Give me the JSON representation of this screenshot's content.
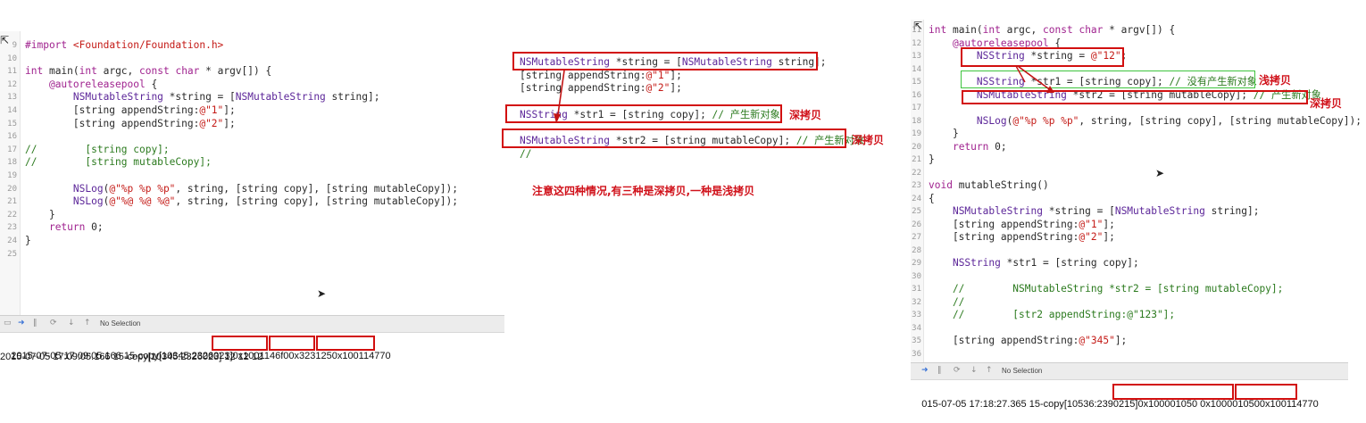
{
  "panel1": {
    "line_numbers": [
      "9",
      "10",
      "11",
      "12",
      "13",
      "14",
      "15",
      "16",
      "17",
      "18",
      "19",
      "20",
      "21",
      "22",
      "23",
      "24",
      "25"
    ],
    "code": [
      "#import <Foundation/Foundation.h>",
      "",
      "int main(int argc, const char * argv[]) {",
      "    @autoreleasepool {",
      "        NSMutableString *string = [NSMutableString string];",
      "        [string appendString:@\"1\"];",
      "        [string appendString:@\"2\"];",
      "",
      "//        [string copy];",
      "//        [string mutableCopy];",
      "",
      "        NSLog(@\"%p %p %p\", string, [string copy], [string mutableCopy]);",
      "        NSLog(@\"%@ %@ %@\", string, [string copy], [string mutableCopy]);",
      "    }",
      "    return 0;",
      "}",
      ""
    ],
    "console": {
      "no_selection": "No Selection",
      "line1_prefix": "2015-07-05 17:09:05.166 15-copy[10345:2326023]",
      "addr1": "0x1001146f0",
      "addr2": "0x323125",
      "addr3": "0x100114770",
      "line2": "2015-07-05 17:09:05.166 15-copy[10345:2326023] 12 12 12"
    }
  },
  "panel2": {
    "code": [
      "NSMutableString *string = [NSMutableString string];",
      "[string appendString:@\"1\"];",
      "[string appendString:@\"2\"];",
      "",
      "NSString *str1 = [string copy]; // 产生新对象",
      "",
      "NSMutableString *str2 = [string mutableCopy]; // 产生新对象",
      "//"
    ],
    "labels": {
      "deep1": "深拷贝",
      "deep2": "深拷贝",
      "note": "注意这四种情况,有三种是深拷贝,一种是浅拷贝"
    }
  },
  "panel3": {
    "line_numbers": [
      "11",
      "12",
      "13",
      "14",
      "15",
      "16",
      "17",
      "18",
      "19",
      "20",
      "21",
      "22",
      "23",
      "24",
      "25",
      "26",
      "27",
      "28",
      "29",
      "30",
      "31",
      "32",
      "33",
      "34",
      "35",
      "36"
    ],
    "code": [
      "int main(int argc, const char * argv[]) {",
      "    @autoreleasepool {",
      "        NSString *string = @\"12\";",
      "",
      "        NSString *str1 = [string copy]; // 没有产生新对象",
      "        NSMutableString *str2 = [string mutableCopy]; // 产生新对象",
      "",
      "        NSLog(@\"%p %p %p\", string, [string copy], [string mutableCopy]);",
      "    }",
      "    return 0;",
      "}",
      "",
      "void mutableString()",
      "{",
      "    NSMutableString *string = [NSMutableString string];",
      "    [string appendString:@\"1\"];",
      "    [string appendString:@\"2\"];",
      "",
      "    NSString *str1 = [string copy];",
      "",
      "    //        NSMutableString *str2 = [string mutableCopy];",
      "    //",
      "    //        [str2 appendString:@\"123\"];",
      "",
      "    [string appendString:@\"345\"];",
      ""
    ],
    "labels": {
      "shallow": "浅拷贝",
      "deep": "深拷贝"
    },
    "console": {
      "no_selection": "No Selection",
      "line_prefix": "015-07-05 17:18:27.365 15-copy[10536:2390215]",
      "addrs": "0x100001050 0x100001050",
      "addr3": "0x100114770"
    }
  }
}
